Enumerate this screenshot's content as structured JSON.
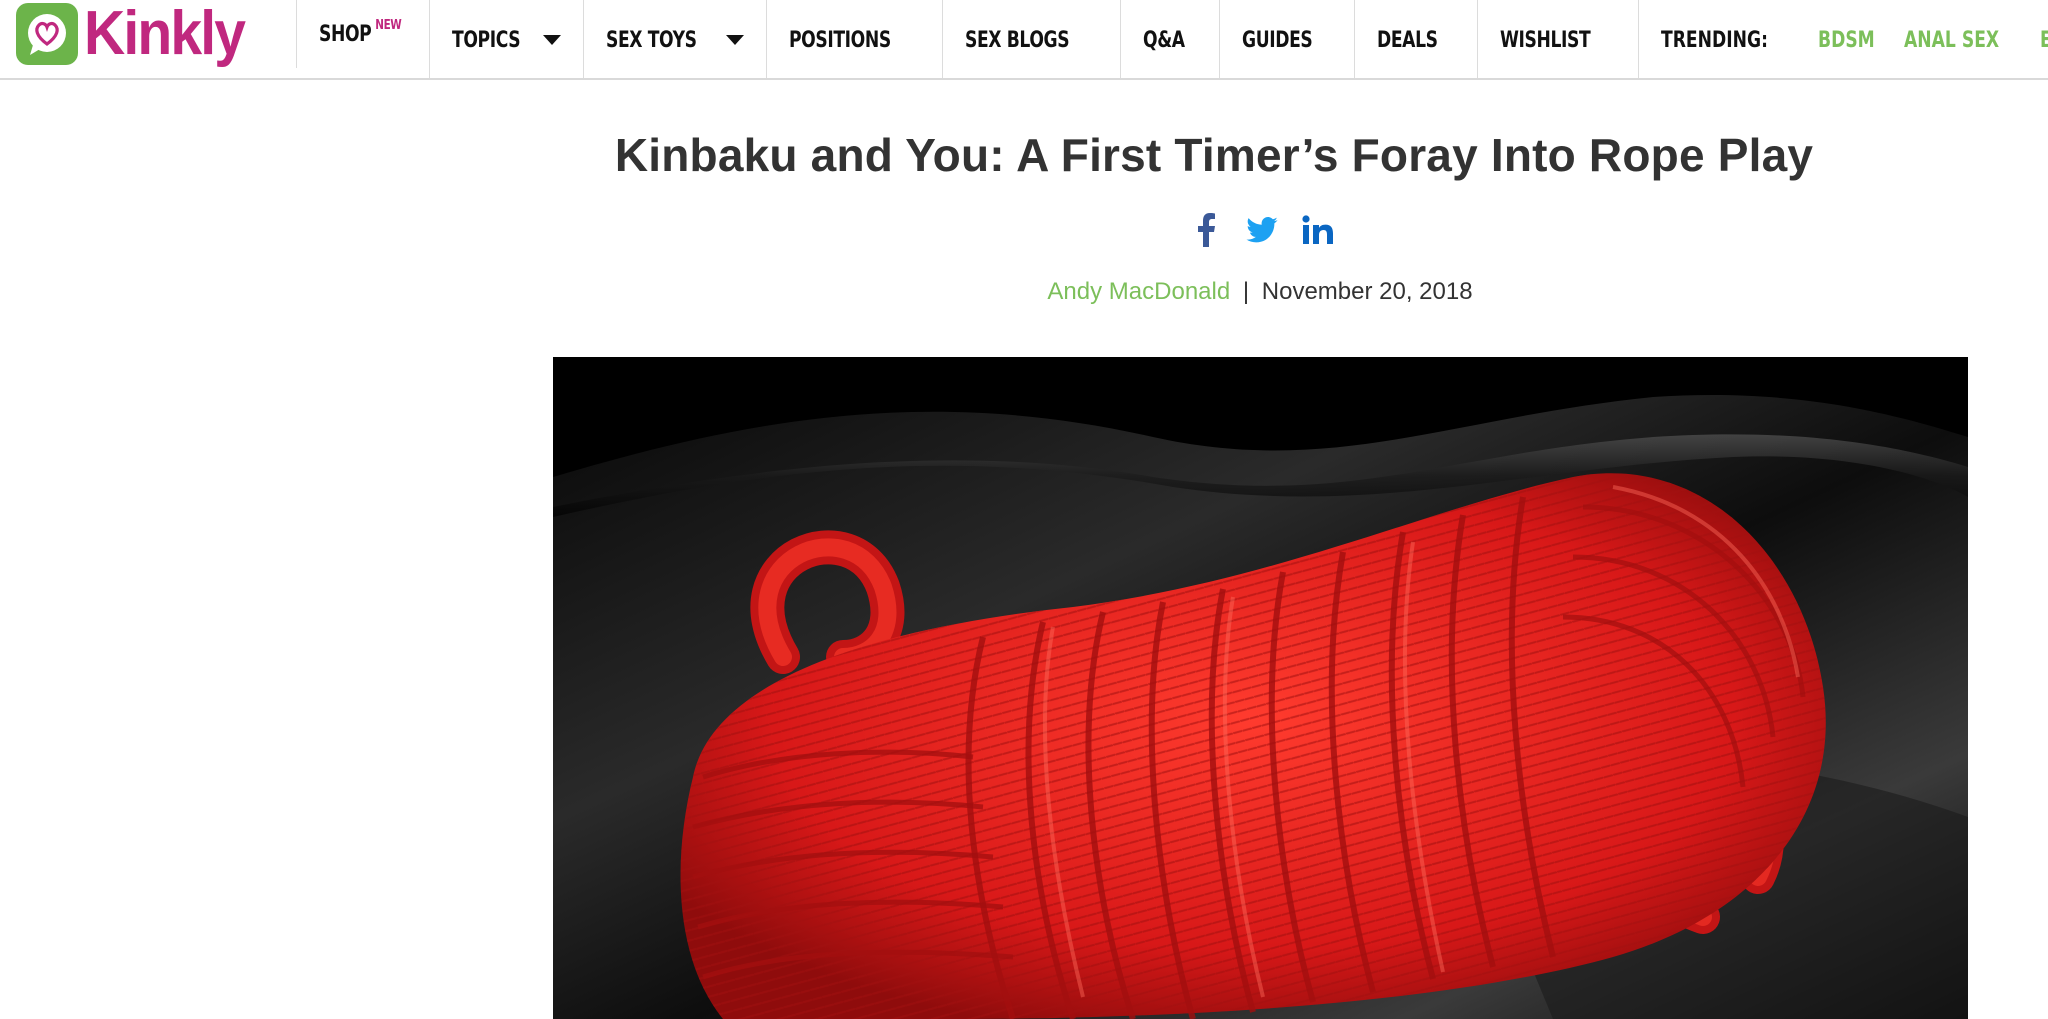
{
  "header": {
    "logo_text": "Kinkly",
    "nav": [
      {
        "label": "SHOP",
        "badge": "NEW",
        "has_caret": false
      },
      {
        "label": "TOPICS",
        "has_caret": true
      },
      {
        "label": "SEX TOYS",
        "has_caret": true
      },
      {
        "label": "POSITIONS",
        "has_caret": false
      },
      {
        "label": "SEX BLOGS",
        "has_caret": false
      },
      {
        "label": "Q&A",
        "has_caret": false
      },
      {
        "label": "GUIDES",
        "has_caret": false
      },
      {
        "label": "DEALS",
        "has_caret": false
      },
      {
        "label": "WISHLIST",
        "has_caret": false
      }
    ],
    "trending_label": "TRENDING:",
    "trending": [
      "BDSM",
      "ANAL SEX",
      "ELECTROSEX"
    ]
  },
  "article": {
    "title": "Kinbaku and You: A First Timer’s Foray Into Rope Play",
    "share_icons": [
      "facebook-icon",
      "twitter-icon",
      "linkedin-icon"
    ],
    "author": "Andy MacDonald",
    "separator": "|",
    "date": "November 20, 2018",
    "hero_image": "red-rope-coil-on-black-satin"
  },
  "colors": {
    "brand_pink": "#c0287f",
    "brand_green": "#6cb44a",
    "link_green": "#7cbf5a",
    "facebook": "#3b5998",
    "twitter": "#1da1f2",
    "linkedin": "#0a66c2",
    "rope_red": "#e21e1e"
  }
}
